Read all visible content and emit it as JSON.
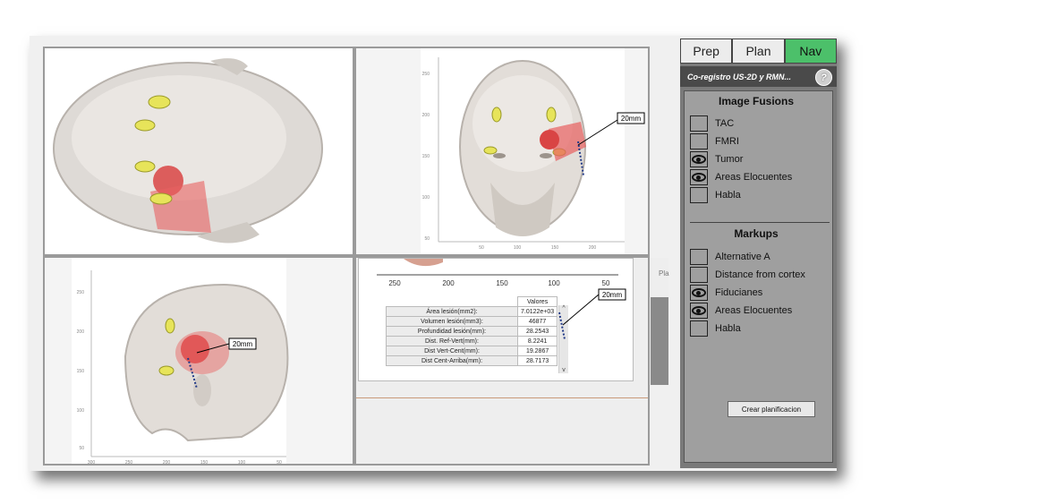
{
  "tabs": [
    {
      "label": "Prep"
    },
    {
      "label": "Plan"
    },
    {
      "label": "Nav",
      "active": true
    }
  ],
  "subtitle": "Co-registro US-2D y RMN...",
  "help_label": "?",
  "image_fusions": {
    "title": "Image Fusions",
    "items": [
      {
        "label": "TAC",
        "visible": false
      },
      {
        "label": "FMRI",
        "visible": false
      },
      {
        "label": "Tumor",
        "visible": true
      },
      {
        "label": "Areas Elocuentes",
        "visible": true
      },
      {
        "label": "Habla",
        "visible": false
      }
    ]
  },
  "markups": {
    "title": "Markups",
    "items": [
      {
        "label": "Alternative A",
        "visible": false
      },
      {
        "label": "Distance from cortex",
        "visible": false
      },
      {
        "label": "Fiducianes",
        "visible": true
      },
      {
        "label": "Areas Elocuentes",
        "visible": true
      },
      {
        "label": "Habla",
        "visible": false
      }
    ]
  },
  "plan_button": "Crear planificacion",
  "strip_label": "Pla",
  "frontal_view": {
    "annotation": "20mm",
    "y_ticks": [
      "250",
      "200",
      "150",
      "100",
      "50"
    ],
    "x_ticks": [
      "50",
      "100",
      "150",
      "200"
    ]
  },
  "lateral_view": {
    "annotation": "20mm",
    "y_ticks": [
      "250",
      "200",
      "150",
      "100",
      "50"
    ],
    "x_ticks": [
      "300",
      "250",
      "200",
      "150",
      "100",
      "50"
    ]
  },
  "detail_view": {
    "annotation": "20mm",
    "x_ticks": [
      "250",
      "200",
      "150",
      "100",
      "50"
    ],
    "table_header": "Valores",
    "rows": [
      {
        "k": "Área lesión(mm2):",
        "v": "7.0122e+03"
      },
      {
        "k": "Volumen lesión(mm3):",
        "v": "46877"
      },
      {
        "k": "Profundidad lesión(mm):",
        "v": "28.2543"
      },
      {
        "k": "Dist. Ref-Vert(mm):",
        "v": "8.2241"
      },
      {
        "k": "Dist Vert-Cent(mm):",
        "v": "19.2867"
      },
      {
        "k": "Dist Cent-Arriba(mm):",
        "v": "28.7173"
      }
    ]
  }
}
